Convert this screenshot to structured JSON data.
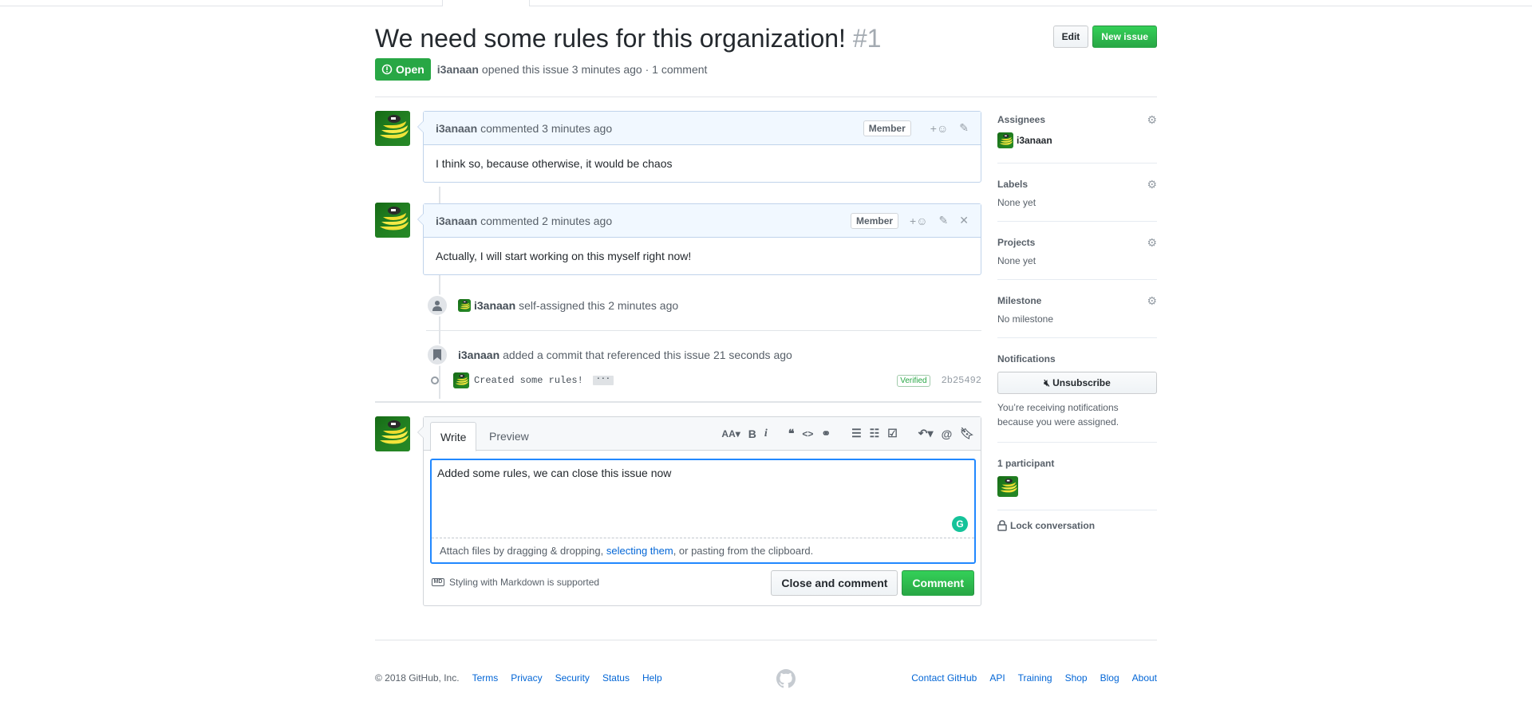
{
  "issue": {
    "title": "We need some rules for this organization!",
    "number": "#1",
    "state": "Open",
    "author": "i3anaan",
    "opened_text": "opened this issue 3 minutes ago · 1 comment"
  },
  "header_actions": {
    "edit": "Edit",
    "new_issue": "New issue"
  },
  "comments": [
    {
      "author": "i3anaan",
      "meta": "commented 3 minutes ago",
      "badge": "Member",
      "body": "I think so, because otherwise, it would be chaos"
    },
    {
      "author": "i3anaan",
      "meta": "commented 2 minutes ago",
      "badge": "Member",
      "body": "Actually, I will start working on this myself right now!"
    }
  ],
  "events": {
    "assign": {
      "actor": "i3anaan",
      "text": "self-assigned this 2 minutes ago"
    },
    "reference": {
      "actor": "i3anaan",
      "text": "added a commit that referenced this issue 21 seconds ago"
    },
    "commit": {
      "message": "Created some rules!",
      "ellipsis": "···",
      "verified": "Verified",
      "sha": "2b25492"
    }
  },
  "editor": {
    "tab_write": "Write",
    "tab_preview": "Preview",
    "text": "Added some rules, we can close this issue now",
    "attach_prefix": "Attach files by dragging & dropping, ",
    "attach_link": "selecting them",
    "attach_suffix": ", or pasting from the clipboard.",
    "markdown_note": "Styling with Markdown is supported",
    "markdown_icon": "MD",
    "grammarly_icon": "G",
    "close_button": "Close and comment",
    "comment_button": "Comment",
    "toolbar": {
      "header": "AA",
      "bold": "B",
      "italic": "i"
    }
  },
  "sidebar": {
    "assignees": {
      "title": "Assignees",
      "value": "i3anaan"
    },
    "labels": {
      "title": "Labels",
      "value": "None yet"
    },
    "projects": {
      "title": "Projects",
      "value": "None yet"
    },
    "milestone": {
      "title": "Milestone",
      "value": "No milestone"
    },
    "notifications": {
      "title": "Notifications",
      "button": "Unsubscribe",
      "note": "You’re receiving notifications because you were assigned."
    },
    "participants": {
      "title": "1 participant"
    },
    "lock": "Lock conversation"
  },
  "footer": {
    "copyright": "© 2018 GitHub, Inc.",
    "left_links": [
      "Terms",
      "Privacy",
      "Security",
      "Status",
      "Help"
    ],
    "right_links": [
      "Contact GitHub",
      "API",
      "Training",
      "Shop",
      "Blog",
      "About"
    ]
  },
  "colors": {
    "accent": "#0366d6",
    "open": "#28a745",
    "comment_header": "#f1f8ff",
    "focus": "#2188ff"
  },
  "icons": [
    "issue-opened-icon",
    "smiley-icon",
    "pencil-icon",
    "x-icon",
    "person-icon",
    "bookmark-icon",
    "gear-icon",
    "mute-icon",
    "lock-icon",
    "markdown-icon",
    "github-mark-icon",
    "grammarly-icon"
  ]
}
